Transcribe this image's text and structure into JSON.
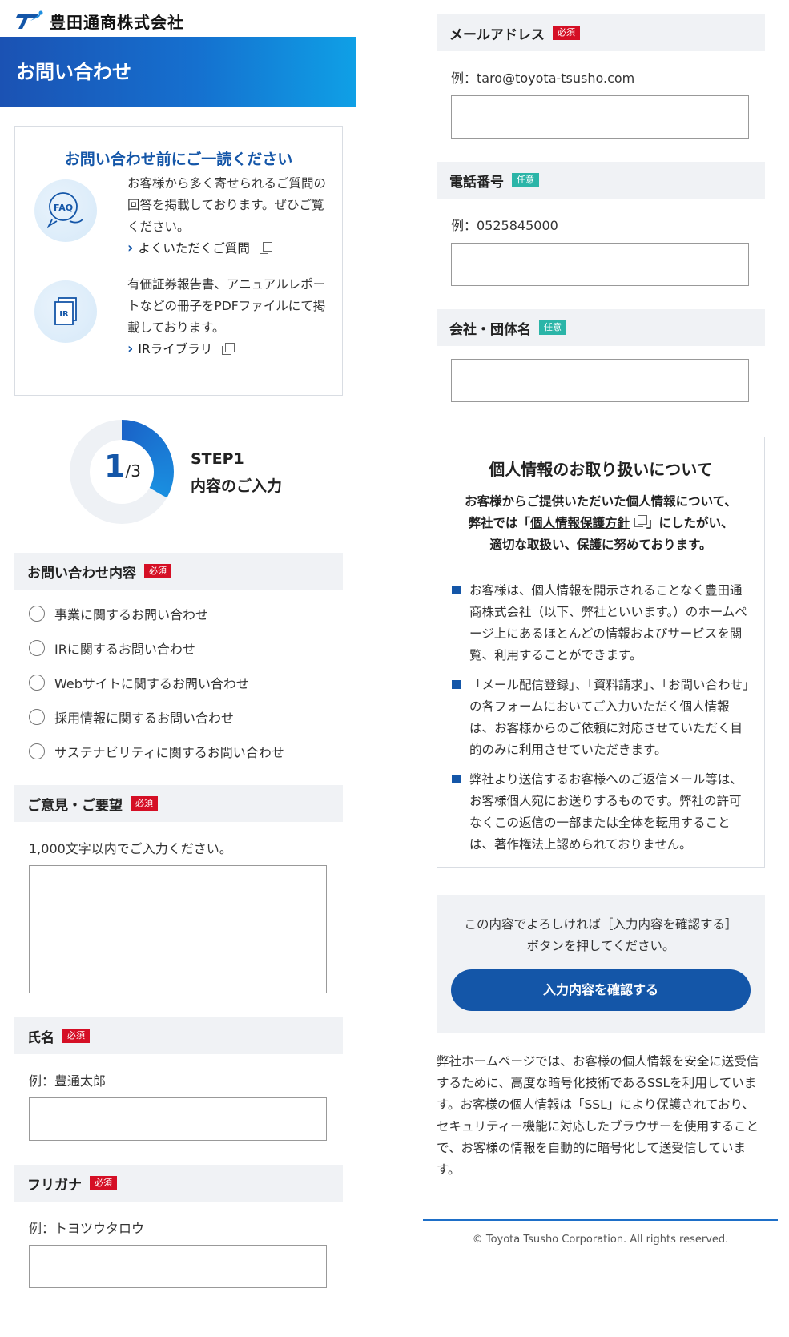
{
  "brand": {
    "name": "豊田通商株式会社"
  },
  "header": {
    "title": "お問い合わせ"
  },
  "preread": {
    "title": "お問い合わせ前にご一読ください",
    "faq": {
      "icon": "faq-icon",
      "icon_label": "FAQ",
      "text": "お客様から多く寄せられるご質問の回答を掲載しております。ぜひご覧ください。",
      "link": "よくいただくご質問"
    },
    "ir": {
      "icon": "ir-document-icon",
      "icon_label": "IR",
      "text": "有価証券報告書、アニュアルレポートなどの冊子をPDFファイルにて掲載しております。",
      "link": "IRライブラリ"
    }
  },
  "step": {
    "current": "1",
    "total": "/3",
    "label": "STEP1",
    "sublabel": "内容のご入力"
  },
  "form": {
    "required_badge": "必須",
    "optional_badge": "任意",
    "inquiry": {
      "label": "お問い合わせ内容",
      "options": [
        "事業に関するお問い合わせ",
        "IRに関するお問い合わせ",
        "Webサイトに関するお問い合わせ",
        "採用情報に関するお問い合わせ",
        "サステナビリティに関するお問い合わせ"
      ]
    },
    "opinion": {
      "label": "ご意見・ご要望",
      "hint": "1,000文字以内でご入力ください。",
      "value": ""
    },
    "name": {
      "label": "氏名",
      "hint": "例：豊通太郎",
      "value": ""
    },
    "kana": {
      "label": "フリガナ",
      "hint": "例：トヨツウタロウ",
      "value": ""
    },
    "email": {
      "label": "メールアドレス",
      "hint": "例：taro@toyota-tsusho.com",
      "value": ""
    },
    "phone": {
      "label": "電話番号",
      "hint": "例：0525845000",
      "value": ""
    },
    "company": {
      "label": "会社・団体名",
      "value": ""
    }
  },
  "privacy": {
    "title": "個人情報のお取り扱いについて",
    "lead_1": "お客様からご提供いただいた個人情報について、",
    "lead_2a": "弊社では「",
    "lead_link": "個人情報保護方針",
    "lead_2b": "」にしたがい、",
    "lead_3": "適切な取扱い、保護に努めております。",
    "items": [
      "お客様は、個人情報を開示されることなく豊田通商株式会社（以下、弊社といいます。）のホームページ上にあるほとんどの情報およびサービスを閲覧、利用することができます。",
      "「メール配信登録」、「資料請求」、「お問い合わせ」の各フォームにおいてご入力いただく個人情報は、お客様からのご依頼に対応させていただく目的のみに利用させていただきます。",
      "弊社より送信するお客様へのご返信メール等は、お客様個人宛にお送りするものです。弊社の許可なくこの返信の一部または全体を転用することは、著作権法上認められておりません。"
    ]
  },
  "confirm": {
    "text_1": "この内容でよろしければ［入力内容を確認する］",
    "text_2": "ボタンを押してください。",
    "button": "入力内容を確認する"
  },
  "ssl_note": "弊社ホームページでは、お客様の個人情報を安全に送受信するために、高度な暗号化技術であるSSLを利用しています。お客様の個人情報は「SSL」により保護されており、セキュリティー機能に対応したブラウザーを使用することで、お客様の情報を自動的に暗号化して送受信しています。",
  "footer": {
    "copyright": "© Toyota Tsusho Corporation. All rights reserved."
  },
  "colors": {
    "brand_blue": "#1456a8",
    "required_red": "#d50f25",
    "optional_teal": "#2bb5a8",
    "section_bg": "#f0f2f5"
  }
}
